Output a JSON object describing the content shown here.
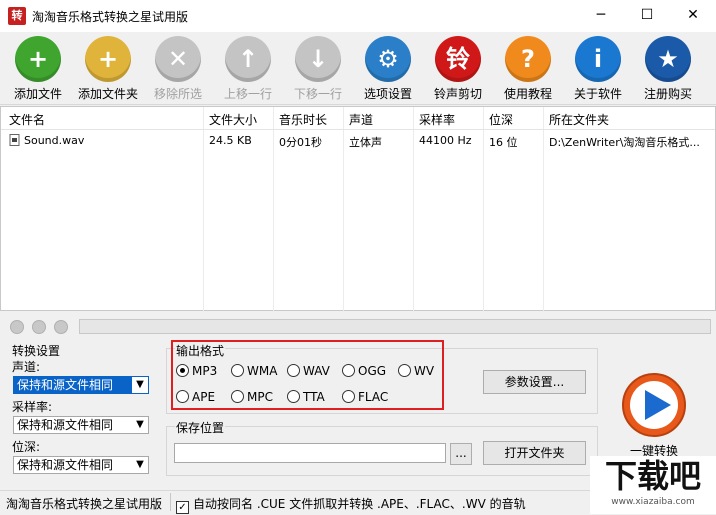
{
  "window": {
    "app_icon_text": "转",
    "title": "淘淘音乐格式转换之星试用版",
    "minimize": "─",
    "maximize": "☐",
    "close": "✕"
  },
  "toolbar": {
    "items": [
      {
        "label": "添加文件",
        "icon": "add-file-icon",
        "color": "#3fa52f",
        "enabled": true
      },
      {
        "label": "添加文件夹",
        "icon": "add-folder-icon",
        "color": "#e0b43a",
        "enabled": true
      },
      {
        "label": "移除所选",
        "icon": "remove-icon",
        "color": "#c4c4c4",
        "enabled": false
      },
      {
        "label": "上移一行",
        "icon": "arrow-up-icon",
        "color": "#c4c4c4",
        "enabled": false
      },
      {
        "label": "下移一行",
        "icon": "arrow-down-icon",
        "color": "#c4c4c4",
        "enabled": false
      },
      {
        "label": "选项设置",
        "icon": "settings-icon",
        "color": "#2a7fc8",
        "enabled": true
      },
      {
        "label": "铃声剪切",
        "icon": "ringtone-icon",
        "color": "#d01818",
        "glyph": "铃",
        "enabled": true
      },
      {
        "label": "使用教程",
        "icon": "help-icon",
        "color": "#f08a1c",
        "glyph": "?",
        "enabled": true
      },
      {
        "label": "关于软件",
        "icon": "info-icon",
        "color": "#1a78d0",
        "glyph": "i",
        "enabled": true
      },
      {
        "label": "注册购买",
        "icon": "register-icon",
        "color": "#1a5aa8",
        "enabled": true
      }
    ]
  },
  "filelist": {
    "columns": [
      "文件名",
      "文件大小",
      "音乐时长",
      "声道",
      "采样率",
      "位深",
      "所在文件夹"
    ],
    "rows": [
      [
        "Sound.wav",
        "24.5 KB",
        "0分01秒",
        "立体声",
        "44100 Hz",
        "16 位",
        "D:\\ZenWriter\\淘淘音乐格式..."
      ]
    ]
  },
  "convert_settings": {
    "title": "转换设置",
    "channel_label": "声道:",
    "channel_value": "保持和源文件相同",
    "samplerate_label": "采样率:",
    "samplerate_value": "保持和源文件相同",
    "bitdepth_label": "位深:",
    "bitdepth_value": "保持和源文件相同"
  },
  "output_format": {
    "title": "输出格式",
    "formats": [
      "MP3",
      "WMA",
      "WAV",
      "OGG",
      "WV",
      "APE",
      "MPC",
      "TTA",
      "FLAC"
    ],
    "selected": "MP3",
    "params_button": "参数设置..."
  },
  "save_location": {
    "title": "保存位置",
    "path_value": "",
    "browse_button": "...",
    "open_folder_button": "打开文件夹"
  },
  "convert_button": {
    "label": "一键转换",
    "color": "#e8581a"
  },
  "statusbar": {
    "app_name": "淘淘音乐格式转换之星试用版",
    "auto_cue_checked": true,
    "auto_cue_label": "自动按同名 .CUE 文件抓取并转换 .APE、.FLAC、.WV 的音轨"
  },
  "watermark": {
    "text": "下载吧",
    "url": "www.xiazaiba.com"
  }
}
